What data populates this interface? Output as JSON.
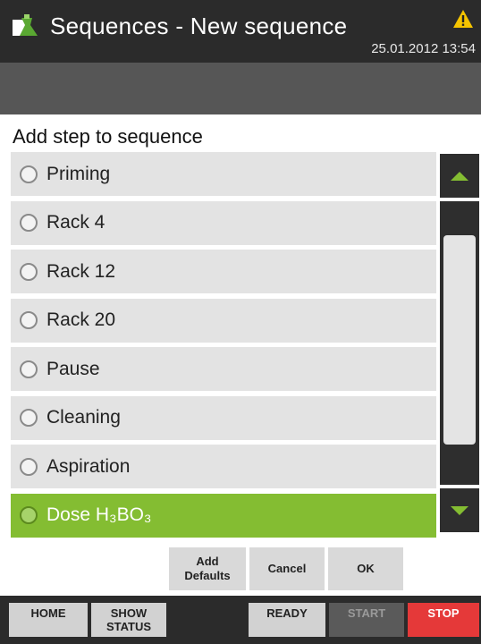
{
  "header": {
    "title": "Sequences - New sequence",
    "datetime": "25.01.2012 13:54",
    "app_icon": "flask-app-icon",
    "warning_icon": "warning-triangle-icon"
  },
  "dialog": {
    "heading": "Add step to sequence",
    "options": [
      {
        "label": "Priming",
        "selected": false
      },
      {
        "label": "Rack 4",
        "selected": false
      },
      {
        "label": "Rack 12",
        "selected": false
      },
      {
        "label": "Rack 20",
        "selected": false
      },
      {
        "label": "Pause",
        "selected": false
      },
      {
        "label": "Cleaning",
        "selected": false
      },
      {
        "label": "Aspiration",
        "selected": false
      },
      {
        "label": "Dose H₃BO₃",
        "selected": true
      }
    ],
    "scroll_up_icon": "arrow-up-icon",
    "scroll_down_icon": "arrow-down-icon"
  },
  "actions": {
    "add_defaults_line1": "Add",
    "add_defaults_line2": "Defaults",
    "cancel": "Cancel",
    "ok": "OK"
  },
  "nav": {
    "home": "HOME",
    "show_status_line1": "SHOW",
    "show_status_line2": "STATUS",
    "ready": "READY",
    "start": "START",
    "stop": "STOP"
  },
  "colors": {
    "accent_green": "#84bd32",
    "stop_red": "#e53939",
    "bar_dark": "#2b2b2b"
  }
}
